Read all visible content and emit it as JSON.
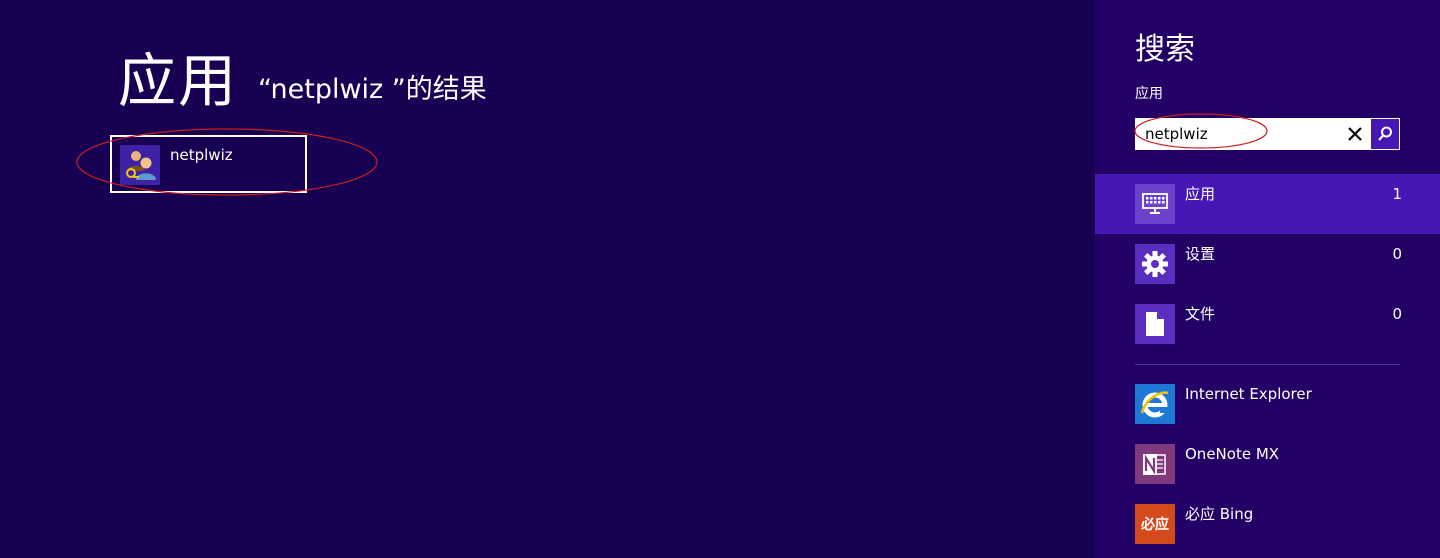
{
  "main": {
    "title": "应用",
    "results_heading": "“netplwiz ”的结果",
    "results": [
      {
        "label": "netplwiz",
        "icon": "users-icon"
      }
    ]
  },
  "search_pane": {
    "title": "搜索",
    "scope": "应用",
    "query": "netplwiz",
    "categories": [
      {
        "label": "应用",
        "count": "1",
        "icon": "keyboard-icon",
        "selected": true
      },
      {
        "label": "设置",
        "count": "0",
        "icon": "gear-icon",
        "selected": false
      },
      {
        "label": "文件",
        "count": "0",
        "icon": "document-icon",
        "selected": false
      }
    ],
    "apps": [
      {
        "label": "Internet Explorer",
        "icon": "internet-explorer-icon"
      },
      {
        "label": "OneNote MX",
        "icon": "onenote-icon"
      },
      {
        "label": "必应 Bing",
        "icon": "bing-icon",
        "icon_text": "必应"
      }
    ]
  },
  "colors": {
    "background": "#180052",
    "pane_background": "#230066",
    "selected": "#4617b4",
    "annotation": "#cc1f1f"
  }
}
